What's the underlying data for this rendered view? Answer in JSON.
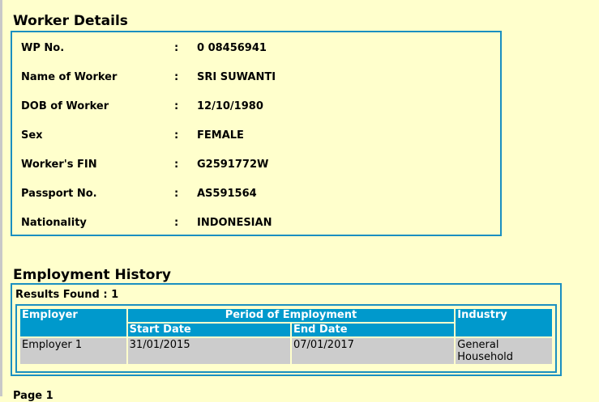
{
  "worker_section": {
    "title": "Worker Details",
    "rows": [
      {
        "label": "WP No.",
        "value": "0 08456941"
      },
      {
        "label": "Name of Worker",
        "value": "SRI SUWANTI"
      },
      {
        "label": "DOB of Worker",
        "value": "12/10/1980"
      },
      {
        "label": "Sex",
        "value": "FEMALE"
      },
      {
        "label": "Worker's FIN",
        "value": "G2591772W"
      },
      {
        "label": "Passport No.",
        "value": "AS591564"
      },
      {
        "label": "Nationality",
        "value": "INDONESIAN"
      }
    ],
    "separator": ":"
  },
  "employment_section": {
    "title": "Employment History",
    "results_found": "Results Found : 1",
    "headers": {
      "employer": "Employer",
      "period": "Period of Employment",
      "start": "Start Date",
      "end": "End Date",
      "industry": "Industry"
    },
    "rows": [
      {
        "employer": "Employer 1",
        "start": "31/01/2015",
        "end": "07/01/2017",
        "industry": "General Household"
      }
    ]
  },
  "pager": {
    "label": "Page 1"
  },
  "colors": {
    "background": "#ffffcc",
    "border": "#1a8fc0",
    "header": "#0099cc",
    "cell": "#cccccc"
  }
}
